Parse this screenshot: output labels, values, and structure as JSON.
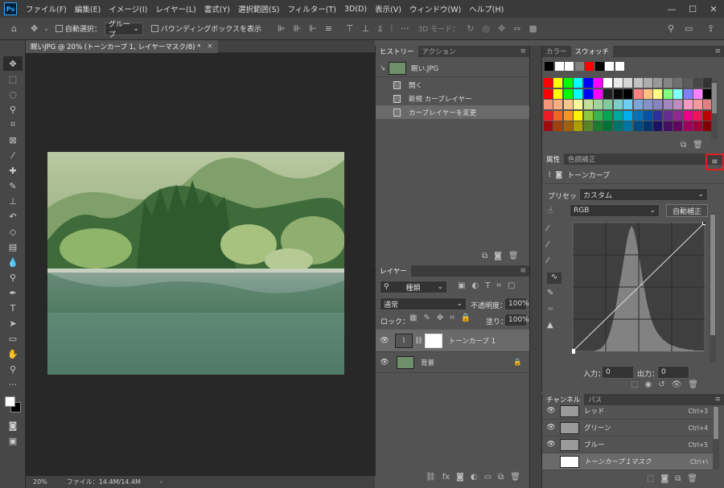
{
  "app": {
    "logo": "Ps"
  },
  "menu": [
    "ファイル(F)",
    "編集(E)",
    "イメージ(I)",
    "レイヤー(L)",
    "書式(Y)",
    "選択範囲(S)",
    "フィルター(T)",
    "3D(D)",
    "表示(V)",
    "ウィンドウ(W)",
    "ヘルプ(H)"
  ],
  "options": {
    "auto_select": "自動選択：",
    "auto_select_value": "グループ",
    "bounding_box": "バウンディングボックスを表示",
    "mode_3d": "3D モード："
  },
  "document": {
    "tab_title": "眠いJPG @ 20% (トーンカーブ 1, レイヤーマスク/8) *",
    "zoom": "20%",
    "file_info": "ファイル：14.4M/14.4M"
  },
  "history": {
    "tabs": [
      "ヒストリー",
      "アクション"
    ],
    "snapshot": "眠い.JPG",
    "items": [
      "開く",
      "新規 カーブレイヤー",
      "カーブレイヤーを変更"
    ]
  },
  "layers": {
    "tab": "レイヤー",
    "filter_kind": "種類",
    "blend_mode": "通常",
    "opacity_label": "不透明度：",
    "opacity_value": "100%",
    "lock_label": "ロック：",
    "fill_label": "塗り：",
    "fill_value": "100%",
    "items": [
      {
        "name": "トーンカーブ 1"
      },
      {
        "name": "背景"
      }
    ]
  },
  "swatches": {
    "tabs": [
      "カラー",
      "スウォッチ"
    ],
    "recent": [
      "#000000",
      "#ffffff",
      "#ffffff",
      "#7f7f7f",
      "#ff0000",
      "#000000",
      "#ffffff",
      "#ffffff"
    ],
    "grid": [
      [
        "#ff0000",
        "#ffff00",
        "#00ff00",
        "#00ffff",
        "#0000ff",
        "#ff00ff",
        "#ffffff",
        "#ebebeb",
        "#d6d6d6",
        "#c2c2c2",
        "#adadad",
        "#999999",
        "#858585",
        "#707070",
        "#5c5c5c",
        "#474747",
        "#333333"
      ],
      [
        "#ff0000",
        "#ffff00",
        "#00ff00",
        "#00ffff",
        "#0000ff",
        "#ff00ff",
        "#1f1f1f",
        "#0a0a0a",
        "#000000",
        "#ff8080",
        "#ffc080",
        "#ffff80",
        "#80ff80",
        "#80ffff",
        "#8080ff",
        "#ff80ff",
        "#000000"
      ],
      [
        "#f7977a",
        "#f9ad81",
        "#fdc68a",
        "#fff79a",
        "#c4df9b",
        "#a2d39c",
        "#82ca9d",
        "#7bcdc8",
        "#6ecff6",
        "#7ea7d8",
        "#8493ca",
        "#8882be",
        "#a187be",
        "#bc8dbf",
        "#f49ac2",
        "#f6989d",
        "#e08080"
      ],
      [
        "#ed1c24",
        "#f26522",
        "#f7941d",
        "#fff200",
        "#8dc73f",
        "#39b54a",
        "#00a651",
        "#00a99d",
        "#00aeef",
        "#0072bc",
        "#0054a6",
        "#2e3192",
        "#662d91",
        "#92278f",
        "#ec008c",
        "#ed145b",
        "#c00000"
      ],
      [
        "#9e0b0f",
        "#a0410d",
        "#a36209",
        "#aba000",
        "#598527",
        "#1a7b30",
        "#007236",
        "#00746b",
        "#0076a3",
        "#004b80",
        "#003471",
        "#1b1464",
        "#440e62",
        "#630460",
        "#9e005d",
        "#9e0039",
        "#800000"
      ]
    ]
  },
  "properties": {
    "tabs": [
      "属性",
      "色調補正"
    ],
    "layer_type": "トーンカーブ",
    "preset_label": "プリセット：",
    "preset_value": "カスタム",
    "channel_value": "RGB",
    "auto_button": "自動補正",
    "input_label": "入力：",
    "input_value": "0",
    "output_label": "出力：",
    "output_value": "0",
    "curve_points": [
      [
        0,
        0
      ],
      [
        255,
        255
      ]
    ]
  },
  "channels": {
    "tabs": [
      "チャンネル",
      "パス"
    ],
    "items": [
      {
        "name": "レッド",
        "shortcut": "Ctrl+3"
      },
      {
        "name": "グリーン",
        "shortcut": "Ctrl+4"
      },
      {
        "name": "ブルー",
        "shortcut": "Ctrl+5"
      },
      {
        "name": "トーンカーブ 1マスク",
        "shortcut": "Ctrl+\\"
      }
    ]
  },
  "colors": {
    "highlight_box": "#e02020",
    "panel_bg": "#535353",
    "canvas_bg": "#282828"
  }
}
